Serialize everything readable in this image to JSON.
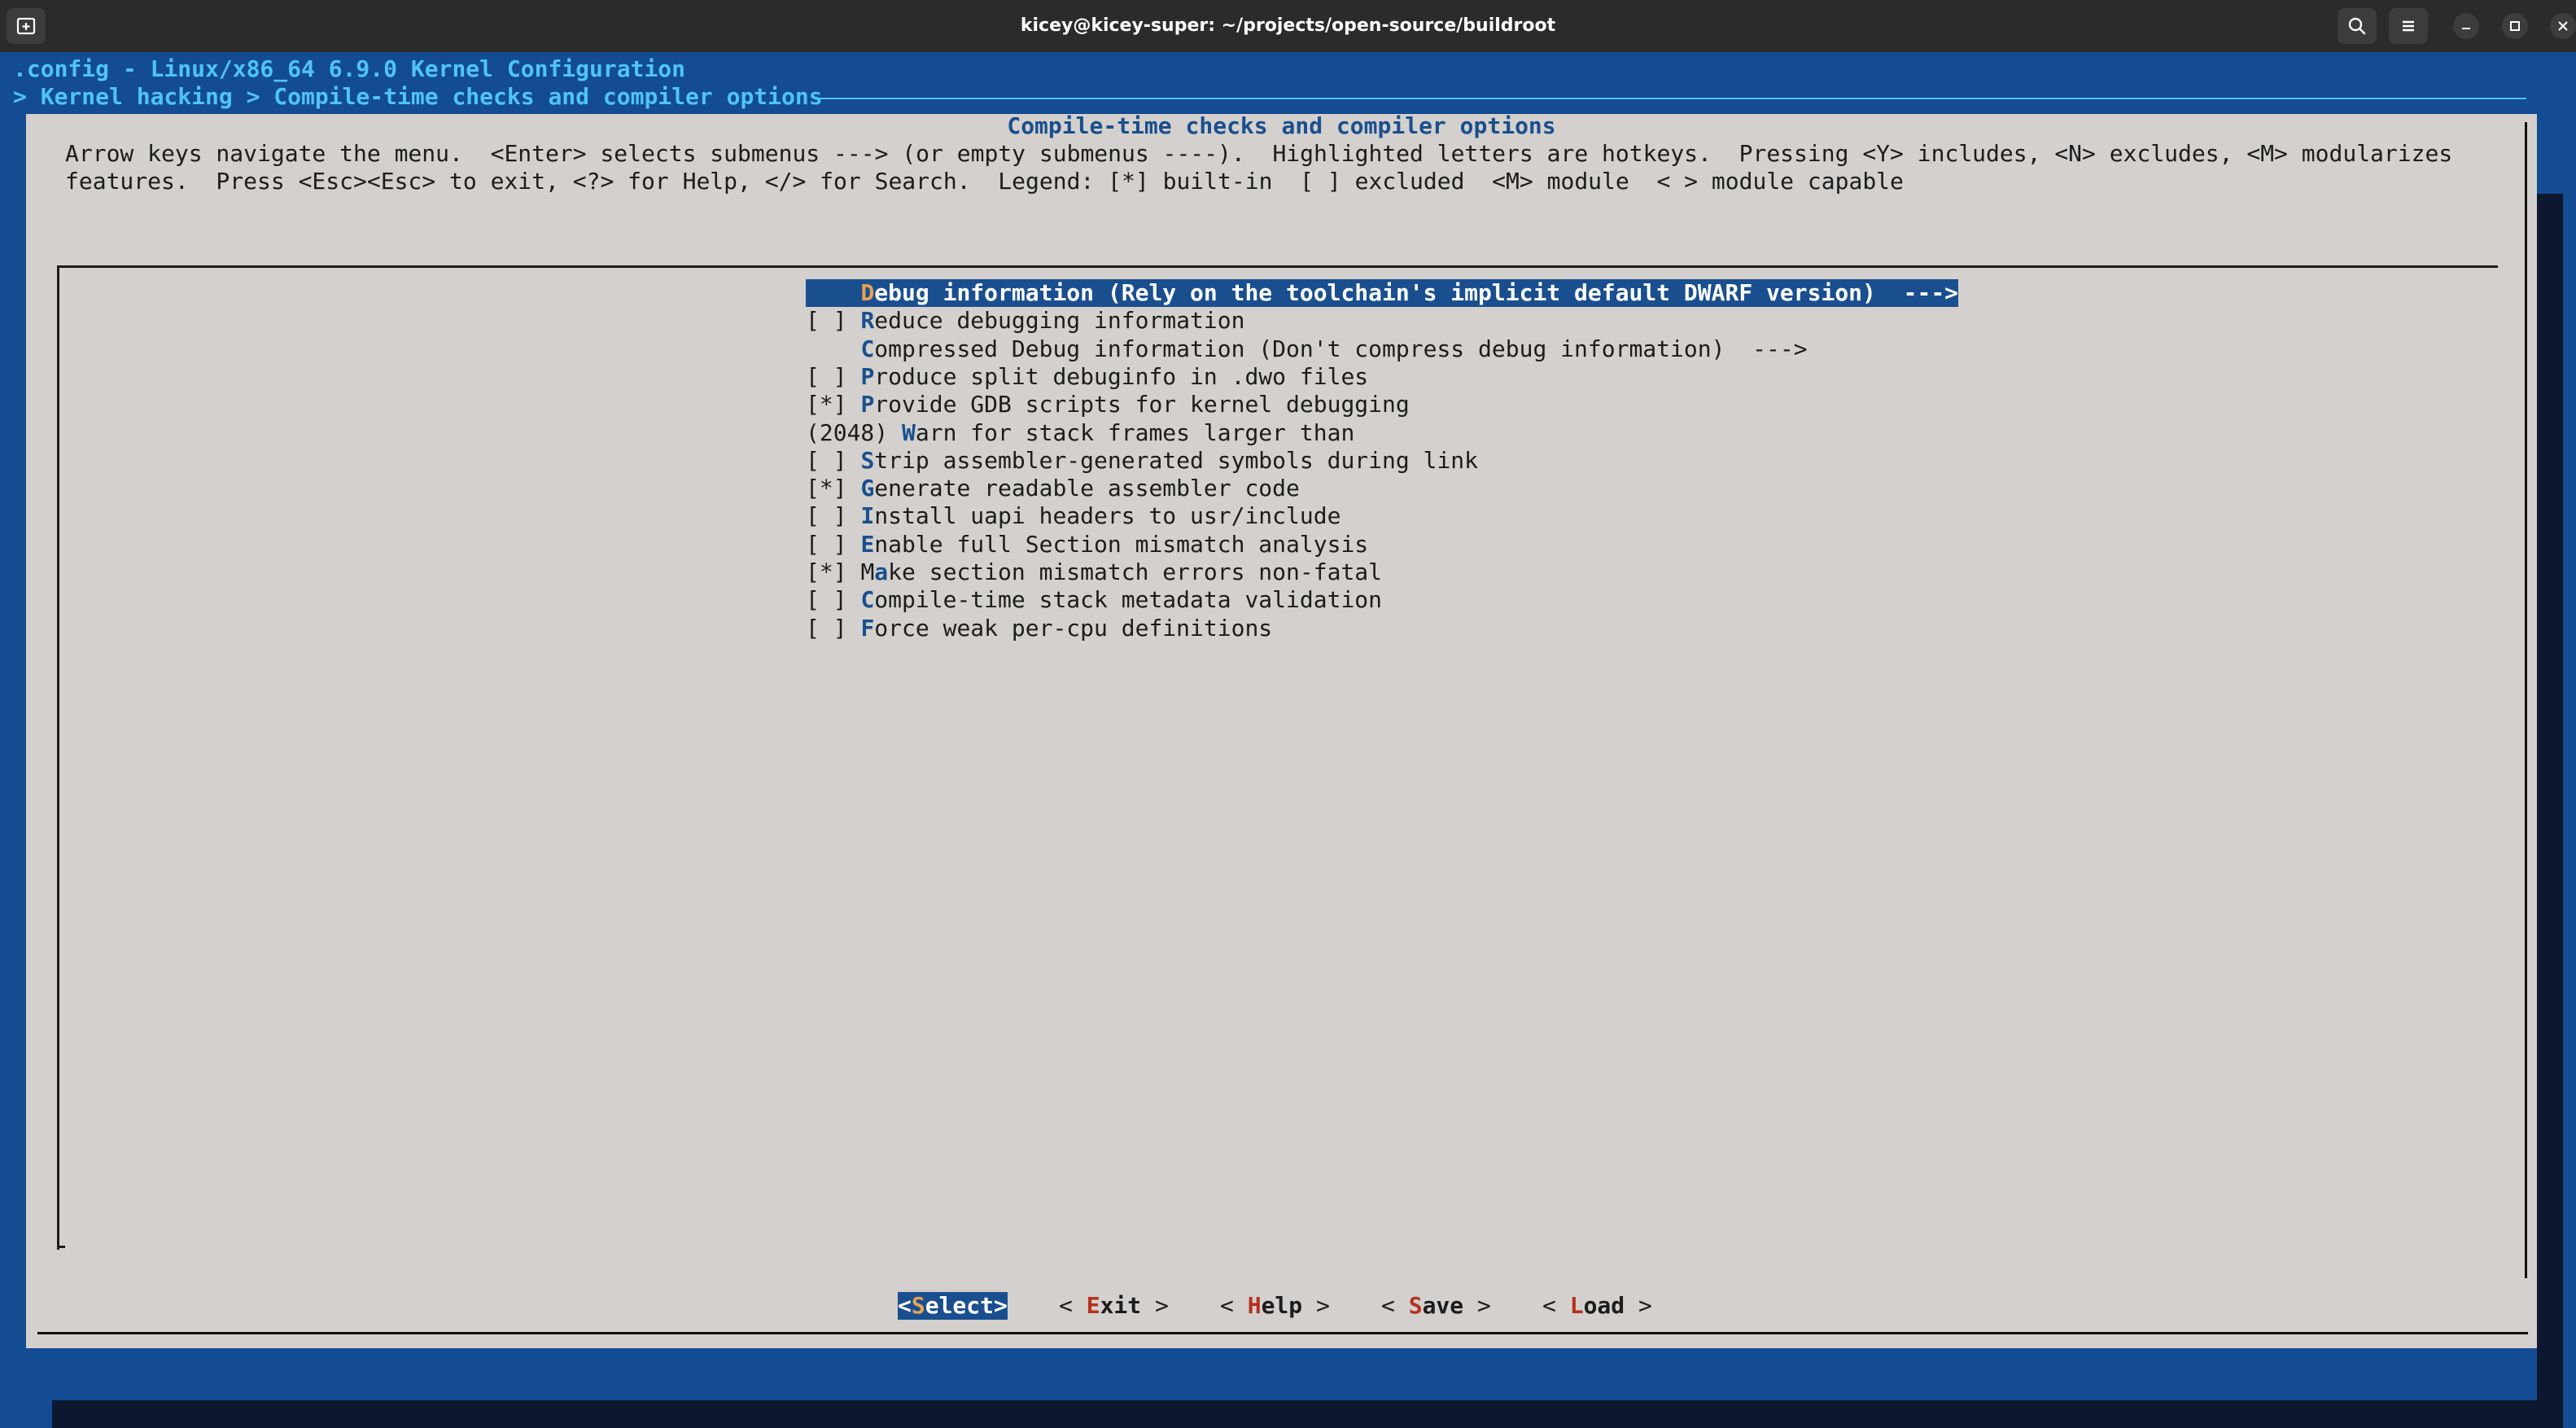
{
  "window": {
    "title": "kicey@kicey-super: ~/projects/open-source/buildroot"
  },
  "icons": {
    "new_tab": "new-tab-icon",
    "search": "search-icon",
    "menu": "hamburger-menu-icon",
    "minimize": "minimize-icon",
    "maximize": "maximize-icon",
    "close": "close-icon"
  },
  "header": {
    "config_line": ".config - Linux/x86_64 6.9.0 Kernel Configuration",
    "breadcrumb": "> Kernel hacking > Compile-time checks and compiler options"
  },
  "dialog": {
    "title": "Compile-time checks and compiler options",
    "help_line1": "Arrow keys navigate the menu.  <Enter> selects submenus ---> (or empty submenus ----).  Highlighted letters are hotkeys.  Pressing <Y> includes, <N> excludes, <M> modularizes",
    "help_line2": "features.  Press <Esc><Esc> to exit, <?> for Help, </> for Search.  Legend: [*] built-in  [ ] excluded  <M> module  < > module capable"
  },
  "menu_items": [
    {
      "prefix": "    ",
      "pre": "",
      "hot": "D",
      "rest": "ebug information (Rely on the toolchain's implicit default DWARF version)  --->",
      "selected": true
    },
    {
      "prefix": "[ ] ",
      "pre": "",
      "hot": "R",
      "rest": "educe debugging information",
      "selected": false
    },
    {
      "prefix": "    ",
      "pre": "",
      "hot": "C",
      "rest": "ompressed Debug information (Don't compress debug information)  --->",
      "selected": false
    },
    {
      "prefix": "[ ] ",
      "pre": "",
      "hot": "P",
      "rest": "roduce split debuginfo in .dwo files",
      "selected": false
    },
    {
      "prefix": "[*] ",
      "pre": "",
      "hot": "P",
      "rest": "rovide GDB scripts for kernel debugging",
      "selected": false
    },
    {
      "prefix": "(2048) ",
      "pre": "",
      "hot": "W",
      "rest": "arn for stack frames larger than",
      "selected": false
    },
    {
      "prefix": "[ ] ",
      "pre": "",
      "hot": "S",
      "rest": "trip assembler-generated symbols during link",
      "selected": false
    },
    {
      "prefix": "[*] ",
      "pre": "",
      "hot": "G",
      "rest": "enerate readable assembler code",
      "selected": false
    },
    {
      "prefix": "[ ] ",
      "pre": "",
      "hot": "I",
      "rest": "nstall uapi headers to usr/include",
      "selected": false
    },
    {
      "prefix": "[ ] ",
      "pre": "",
      "hot": "E",
      "rest": "nable full Section mismatch analysis",
      "selected": false
    },
    {
      "prefix": "[*] ",
      "pre": "M",
      "hot": "a",
      "rest": "ke section mismatch errors non-fatal",
      "selected": false
    },
    {
      "prefix": "[ ] ",
      "pre": "",
      "hot": "C",
      "rest": "ompile-time stack metadata validation",
      "selected": false
    },
    {
      "prefix": "[ ] ",
      "pre": "",
      "hot": "F",
      "rest": "orce weak per-cpu definitions",
      "selected": false
    }
  ],
  "buttons": [
    {
      "open": "<",
      "hot": "S",
      "rest": "elect",
      "close": ">",
      "selected": true
    },
    {
      "open": "< ",
      "hot": "E",
      "rest": "xit",
      "close": " >",
      "selected": false
    },
    {
      "open": "< ",
      "hot": "H",
      "rest": "elp",
      "close": " >",
      "selected": false
    },
    {
      "open": "< ",
      "hot": "S",
      "rest": "ave",
      "close": " >",
      "selected": false
    },
    {
      "open": "< ",
      "hot": "L",
      "rest": "oad",
      "close": " >",
      "selected": false
    }
  ]
}
